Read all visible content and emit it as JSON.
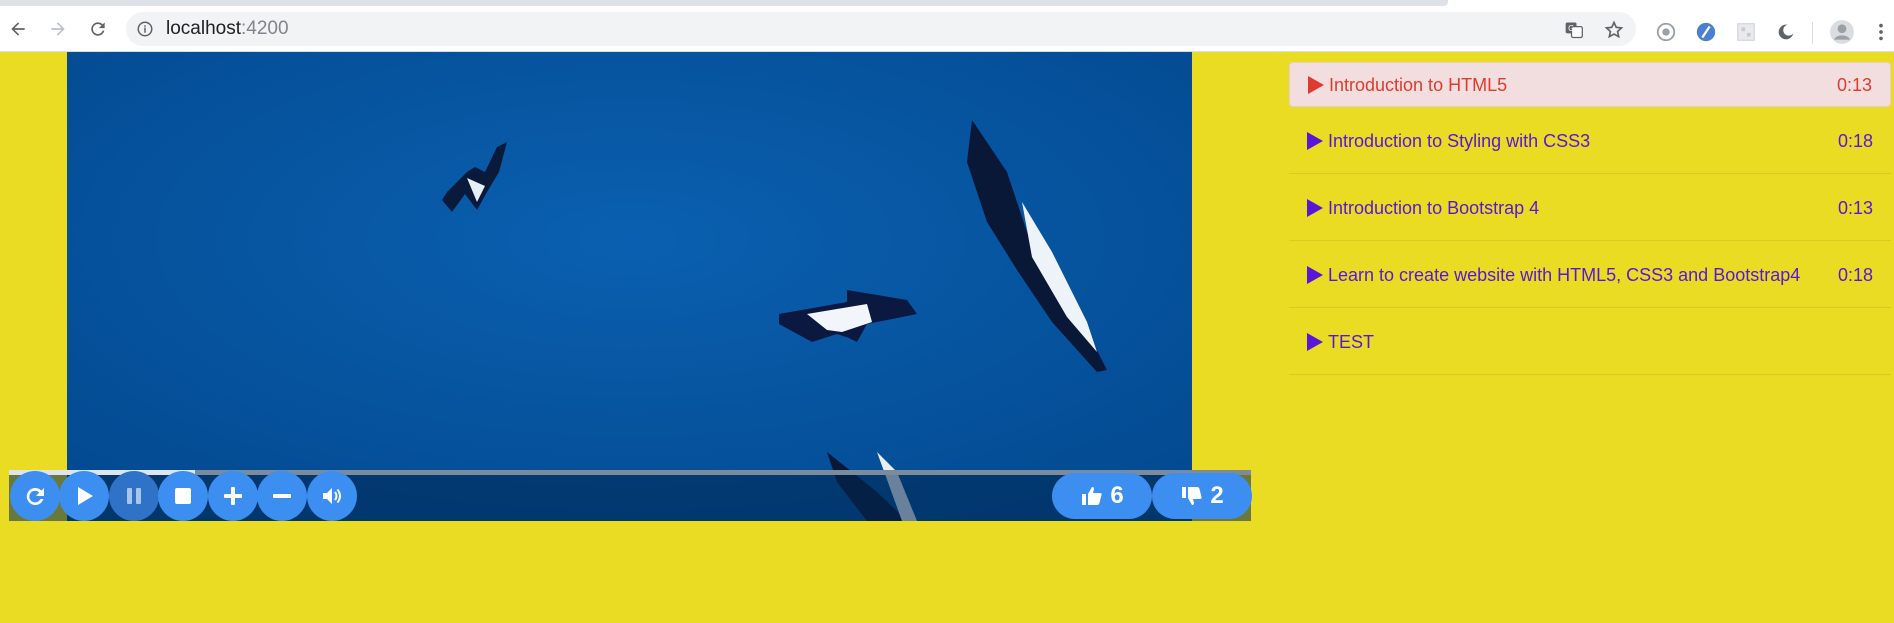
{
  "browser": {
    "url_host": "localhost",
    "url_port": ":4200"
  },
  "player": {
    "progress_fraction": 0.15,
    "likes": "6",
    "dislikes": "2",
    "colors": {
      "button": "#3c8ef0",
      "video_bg": "#04519b"
    }
  },
  "playlist": {
    "items": [
      {
        "title": "Introduction to HTML5",
        "duration": "0:13",
        "active": true
      },
      {
        "title": "Introduction to Styling with CSS3",
        "duration": "0:18",
        "active": false
      },
      {
        "title": "Introduction to Bootstrap 4",
        "duration": "0:13",
        "active": false
      },
      {
        "title": "Learn to create website with HTML5, CSS3 and Bootstrap4",
        "duration": "0:18",
        "active": false
      },
      {
        "title": "TEST",
        "duration": "",
        "active": false
      }
    ],
    "colors": {
      "active_text": "#e03a2f",
      "text": "#5a16d8",
      "page_bg": "#e9dc22"
    }
  },
  "icons": {
    "controls": [
      "replay-icon",
      "play-icon",
      "pause-icon",
      "stop-icon",
      "plus-icon",
      "minus-icon",
      "volume-icon"
    ],
    "votes": [
      "thumbs-up-icon",
      "thumbs-down-icon"
    ]
  }
}
